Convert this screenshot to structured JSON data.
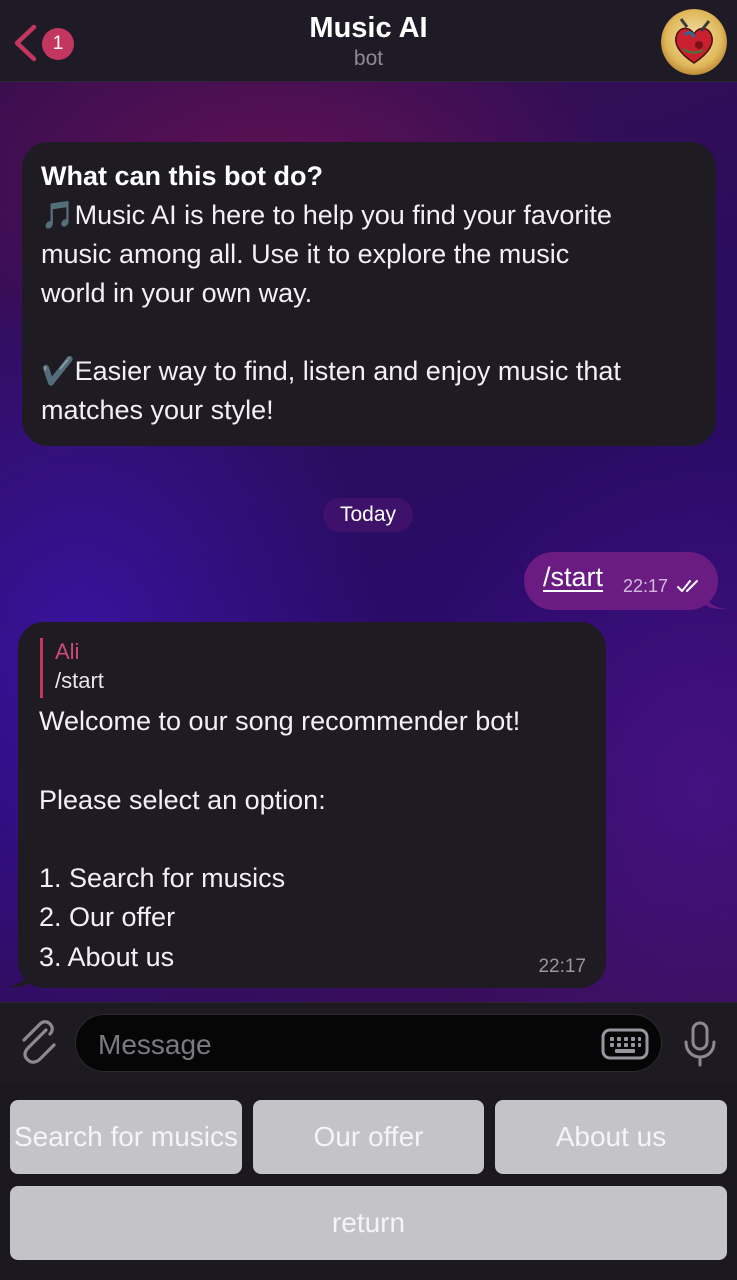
{
  "header": {
    "title": "Music AI",
    "subtitle": "bot",
    "back_badge": "1",
    "accent_color": "#c2365f"
  },
  "intro": {
    "title": "What can this bot do?",
    "text": "🎵Music AI is here to help you find your favorite\nmusic among all. Use it to explore the music\nworld in your own way.\n\n✔️Easier way to find, listen and enjoy music that\nmatches your style!"
  },
  "date_separator": "Today",
  "outgoing": {
    "text": "/start",
    "time": "22:17",
    "status_icon": "double-check-icon"
  },
  "reply": {
    "quote_name": "Ali",
    "quote_text": "/start",
    "text": "Welcome to our song recommender bot!\n\nPlease select an option:\n\n1. Search for musics\n2. Our offer\n3. About us",
    "time": "22:17"
  },
  "input": {
    "placeholder": "Message"
  },
  "keyboard": {
    "buttons": [
      "Search for musics",
      "Our offer",
      "About us",
      "return"
    ]
  }
}
